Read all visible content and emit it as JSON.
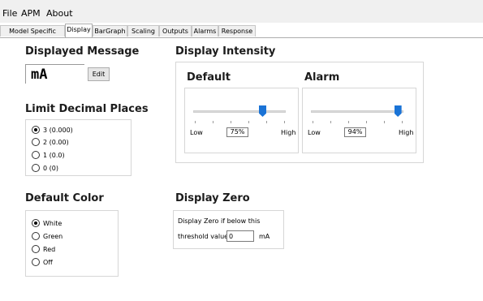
{
  "menu": {
    "file": "File",
    "apm": "APM",
    "about": "About"
  },
  "tabs": [
    "Model Specific",
    "Display",
    "BarGraph",
    "Scaling",
    "Outputs",
    "Alarms",
    "Response"
  ],
  "active_tab": "Display",
  "displayed_message": {
    "title": "Displayed Message",
    "value": "mA",
    "edit_label": "Edit"
  },
  "limit_decimal": {
    "title": "Limit Decimal Places",
    "options": [
      "3 (0.000)",
      "2 (0.00)",
      "1 (0.0)",
      "0 (0)"
    ],
    "selected": "3 (0.000)"
  },
  "default_color": {
    "title": "Default Color",
    "options": [
      "White",
      "Green",
      "Red",
      "Off"
    ],
    "selected": "White"
  },
  "display_intensity": {
    "title": "Display Intensity",
    "default": {
      "label": "Default",
      "low": "Low",
      "high": "High",
      "value_text": "75%",
      "value": 0.75
    },
    "alarm": {
      "label": "Alarm",
      "low": "Low",
      "high": "High",
      "value_text": "94%",
      "value": 0.94
    }
  },
  "display_zero": {
    "title": "Display Zero",
    "line1": "Display Zero if below this",
    "line2": "threshold value",
    "value": "0",
    "unit": "mA"
  },
  "colors": {
    "thumb": "#1a73d6",
    "menu_bg": "#f0f0f0"
  }
}
